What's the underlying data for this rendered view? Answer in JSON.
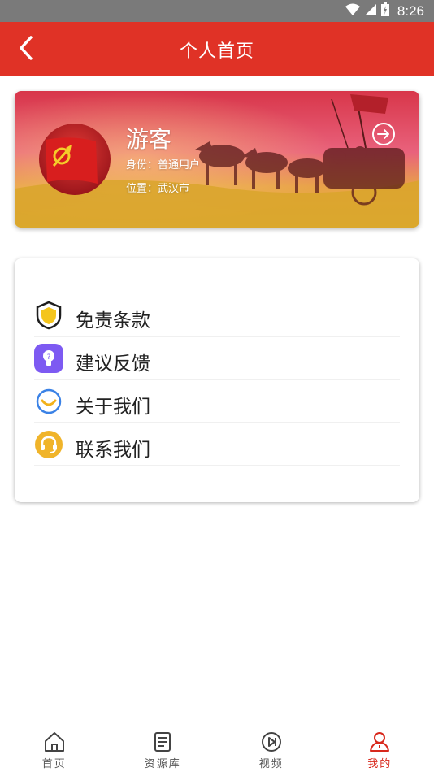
{
  "status_bar": {
    "time": "8:26"
  },
  "header": {
    "title": "个人首页"
  },
  "profile": {
    "name": "游客",
    "identity": "身份：普通用户",
    "location": "位置：武汉市"
  },
  "menu": [
    {
      "label": "免责条款",
      "icon": "shield-icon"
    },
    {
      "label": "建议反馈",
      "icon": "lightbulb-icon"
    },
    {
      "label": "关于我们",
      "icon": "smile-icon"
    },
    {
      "label": "联系我们",
      "icon": "headset-icon"
    }
  ],
  "tabs": [
    {
      "label": "首页",
      "icon": "home-icon"
    },
    {
      "label": "资源库",
      "icon": "document-icon"
    },
    {
      "label": "视频",
      "icon": "video-icon"
    },
    {
      "label": "我的",
      "icon": "user-icon",
      "active": true
    }
  ],
  "colors": {
    "primary": "#e03226",
    "tab_active": "#d8281c"
  }
}
